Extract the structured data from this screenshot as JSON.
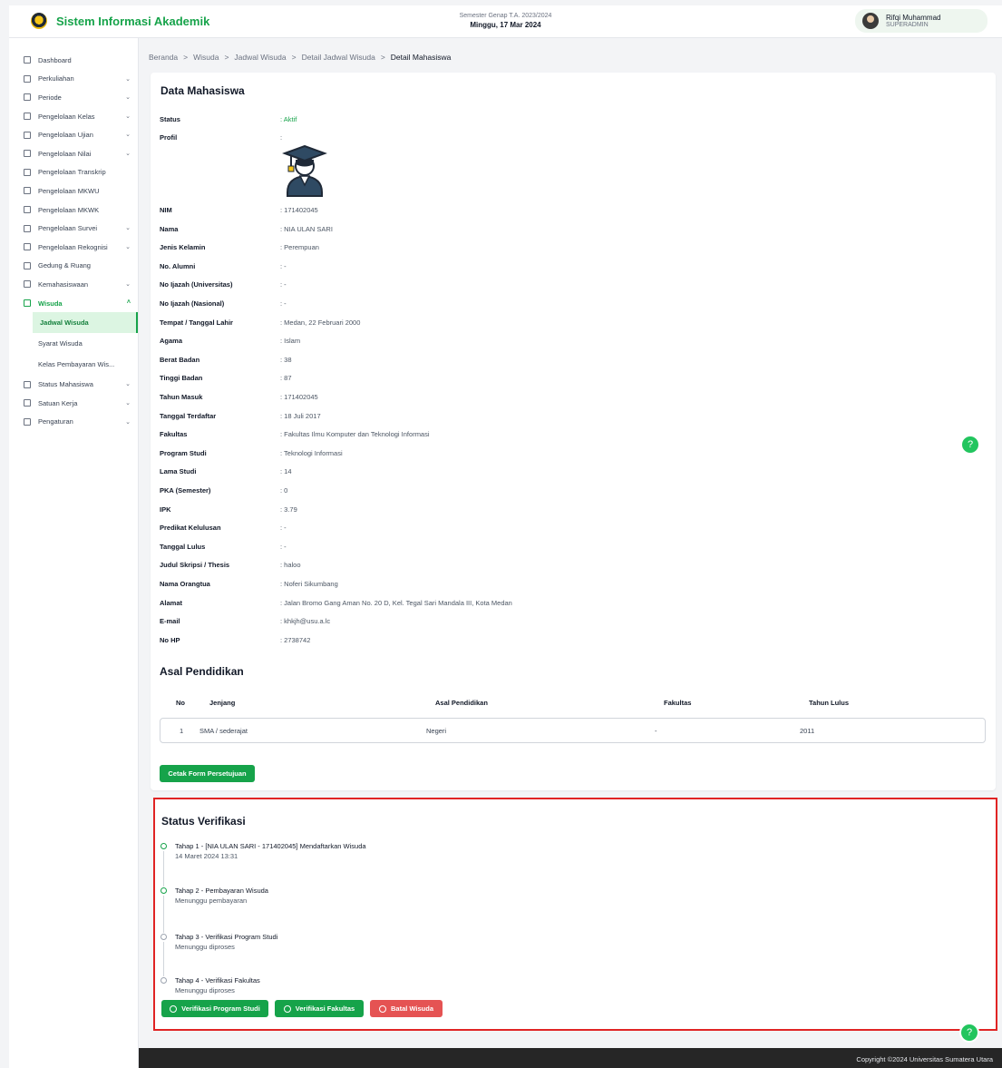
{
  "app": {
    "name": "Sistem Informasi Akademik"
  },
  "header": {
    "semester": "Semester Genap T.A. 2023/2024",
    "date": "Minggu, 17 Mar 2024",
    "user_name": "Rifqi Muhammad",
    "user_role": "SUPERADMIN"
  },
  "sidebar": {
    "items": [
      {
        "label": "Dashboard",
        "icon": "dashboard-icon",
        "chevron": ""
      },
      {
        "label": "Perkuliahan",
        "icon": "book-icon",
        "chevron": "⌄"
      },
      {
        "label": "Periode",
        "icon": "calendar-icon",
        "chevron": "⌄"
      },
      {
        "label": "Pengelolaan Kelas",
        "icon": "calendar-icon",
        "chevron": "⌄"
      },
      {
        "label": "Pengelolaan Ujian",
        "icon": "file-icon",
        "chevron": "⌄"
      },
      {
        "label": "Pengelolaan Nilai",
        "icon": "trophy-icon",
        "chevron": "⌄"
      },
      {
        "label": "Pengelolaan Transkrip",
        "icon": "document-icon",
        "chevron": ""
      },
      {
        "label": "Pengelolaan MKWU",
        "icon": "calendar-icon",
        "chevron": ""
      },
      {
        "label": "Pengelolaan MKWK",
        "icon": "calendar-icon",
        "chevron": ""
      },
      {
        "label": "Pengelolaan Survei",
        "icon": "building-icon",
        "chevron": "⌄"
      },
      {
        "label": "Pengelolaan Rekognisi",
        "icon": "calendar-icon",
        "chevron": "⌄"
      },
      {
        "label": "Gedung & Ruang",
        "icon": "building-icon",
        "chevron": ""
      },
      {
        "label": "Kemahasiswaan",
        "icon": "id-card-icon",
        "chevron": "⌄"
      },
      {
        "label": "Wisuda",
        "icon": "graduation-icon",
        "chevron": "˄"
      }
    ],
    "wisuda_sub": [
      "Jadwal Wisuda",
      "Syarat Wisuda",
      "Kelas Pembayaran Wis..."
    ],
    "items_after": [
      {
        "label": "Status Mahasiswa",
        "icon": "graduation-cap-icon",
        "chevron": "⌄"
      },
      {
        "label": "Satuan Kerja",
        "icon": "building-icon",
        "chevron": "⌄"
      },
      {
        "label": "Pengaturan",
        "icon": "gear-icon",
        "chevron": "⌄"
      }
    ]
  },
  "breadcrumb": {
    "items": [
      "Beranda",
      "Wisuda",
      "Jadwal Wisuda",
      "Detail Jadwal Wisuda"
    ],
    "current": "Detail Mahasiswa",
    "separator": ">"
  },
  "student": {
    "title": "Data Mahasiswa",
    "status_label": "Status",
    "status_value": ": Aktif",
    "profile_label": "Profil",
    "profile_value": ":",
    "fields": [
      {
        "label": "NIM",
        "value": ": 171402045"
      },
      {
        "label": "Nama",
        "value": ": NIA ULAN SARI"
      },
      {
        "label": "Jenis Kelamin",
        "value": ": Perempuan"
      },
      {
        "label": "No. Alumni",
        "value": ": -"
      },
      {
        "label": "No Ijazah (Universitas)",
        "value": ": -"
      },
      {
        "label": "No Ijazah (Nasional)",
        "value": ": -"
      },
      {
        "label": "Tempat / Tanggal Lahir",
        "value": ": Medan, 22 Februari 2000"
      },
      {
        "label": "Agama",
        "value": ": Islam"
      },
      {
        "label": "Berat Badan",
        "value": ": 38"
      },
      {
        "label": "Tinggi Badan",
        "value": ": 87"
      },
      {
        "label": "Tahun Masuk",
        "value": ": 171402045"
      },
      {
        "label": "Tanggal Terdaftar",
        "value": ": 18 Juli 2017"
      },
      {
        "label": "Fakultas",
        "value": ": Fakultas Ilmu Komputer dan Teknologi Informasi"
      },
      {
        "label": "Program Studi",
        "value": ": Teknologi Informasi"
      },
      {
        "label": "Lama Studi",
        "value": ": 14"
      },
      {
        "label": "PKA (Semester)",
        "value": ": 0"
      },
      {
        "label": "IPK",
        "value": ": 3.79"
      },
      {
        "label": "Predikat Kelulusan",
        "value": ": -"
      },
      {
        "label": "Tanggal Lulus",
        "value": ": -"
      },
      {
        "label": "Judul Skripsi / Thesis",
        "value": ": haloo"
      },
      {
        "label": "Nama Orangtua",
        "value": ": Noferi Sikumbang"
      },
      {
        "label": "Alamat",
        "value": ": Jalan Bromo Gang Aman No. 20 D, Kel. Tegal Sari Mandala III, Kota Medan"
      },
      {
        "label": "E-mail",
        "value": ": khkjh@usu.a.lc"
      },
      {
        "label": "No HP",
        "value": ": 2738742"
      }
    ]
  },
  "education": {
    "title": "Asal Pendidikan",
    "headers": [
      "No",
      "Jenjang",
      "Asal Pendidikan",
      "Fakultas",
      "Tahun Lulus"
    ],
    "rows": [
      [
        "1",
        "SMA / sederajat",
        "Negeri",
        "-",
        "2011"
      ]
    ]
  },
  "print_button": "Cetak Form Persetujuan",
  "verification": {
    "title": "Status Verifikasi",
    "steps": [
      {
        "title": "Tahap 1 - [NIA ULAN SARI - 171402045] Mendaftarkan Wisuda",
        "detail": "14 Maret 2024 13:31",
        "done": true
      },
      {
        "title": "Tahap 2 - Pembayaran Wisuda",
        "detail": "Menunggu pembayaran",
        "done": true
      },
      {
        "title": "Tahap 3 - Verifikasi Program Studi",
        "detail": "Menunggu diproses",
        "done": false
      },
      {
        "title": "Tahap 4 - Verifikasi Fakultas",
        "detail": "Menunggu diproses",
        "done": false
      }
    ],
    "buttons": {
      "verify_prodi": "Verifikasi Program Studi",
      "verify_fakultas": "Verifikasi Fakultas",
      "cancel": "Batal Wisuda"
    }
  },
  "help": "?",
  "footer": {
    "copyright": "Copyright ©2024 Universitas Sumatera Utara"
  },
  "colors": {
    "accent": "#16a34a",
    "danger": "#e55353",
    "highlight_border": "#e02424"
  }
}
